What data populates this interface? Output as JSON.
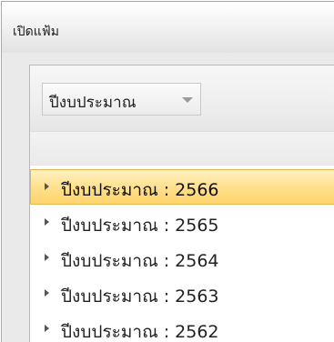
{
  "window": {
    "title": "เปิดแฟ้ม"
  },
  "toolbar": {
    "year_select": {
      "value": "ปีงบประมาณ",
      "icon": "chevron-down-icon"
    }
  },
  "tree": {
    "expander_icon": "triangle-right-icon",
    "selected_index": 0,
    "items": [
      {
        "label": "ปีงบประมาณ : 2566"
      },
      {
        "label": "ปีงบประมาณ : 2565"
      },
      {
        "label": "ปีงบประมาณ : 2564"
      },
      {
        "label": "ปีงบประมาณ : 2563"
      },
      {
        "label": "ปีงบประมาณ : 2562"
      }
    ]
  },
  "colors": {
    "selection": "#ffe08e",
    "selection_border": "#e6b84c"
  }
}
